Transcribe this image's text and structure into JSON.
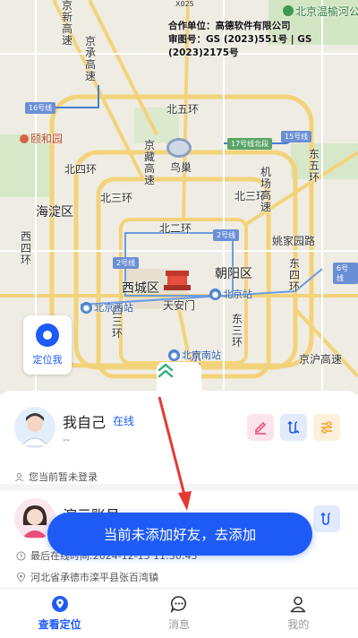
{
  "map": {
    "attribution": {
      "line1": "合作单位：高德软件有限公司",
      "line2": "审图号：GS (2023)551号 | GS (2023)2175号"
    },
    "top_right_label": "北京温榆河公园",
    "top_marker": "X025",
    "labels": {
      "beiwuhuan": "北五环",
      "beisihuan": "北四环",
      "beisanhuan_l": "北三环",
      "beisanhuan_r": "北三环",
      "beierhuan": "北二环",
      "dongwuhuan": "东五环",
      "haidian": "海淀区",
      "chaoyang": "朝阳区",
      "xicheng": "西城区",
      "tiananmen": "天安门",
      "yiheyuan": "颐和园",
      "niaochao": "鸟巢",
      "yaojia": "姚家园路",
      "jingzang": "京藏高速",
      "xisihuan": "西四环",
      "xisanhuan": "西三环",
      "dongsihuan": "东四环",
      "dongsanhuan": "东三环",
      "jingcheng": "京承高速",
      "jingxin": "京新高速",
      "jichang": "机场高速",
      "jinghu": "京沪高速",
      "jingkai": "京开高速"
    },
    "subway": {
      "beijingzhan": "北京站",
      "beijingxi": "北京西站",
      "beijingnan": "北京南站"
    },
    "badges": {
      "line16": "16号线",
      "line17": "17号线北段",
      "line15": "15号线",
      "line2a": "2号线",
      "line2b": "2号线",
      "line6": "6号线"
    },
    "locate_label": "定位我"
  },
  "contacts": [
    {
      "name": "我自己",
      "status": "在线",
      "coords": "--",
      "note": "您当前暂未登录"
    },
    {
      "name": "演示账号",
      "last_online": "最后在线时间:2024-12-13 11:30:43",
      "address": "河北省承德市滦平县张百湾镇"
    }
  ],
  "toast": "当前未添加好友，去添加",
  "tabs": [
    {
      "label": "查看定位",
      "icon": "location-pin-icon"
    },
    {
      "label": "消息",
      "icon": "chat-bubble-icon"
    },
    {
      "label": "我的",
      "icon": "person-icon"
    }
  ],
  "colors": {
    "accent": "#1e5bf6",
    "arrow": "#e53935",
    "edit": "#e8527a",
    "filter": "#f0a020"
  }
}
